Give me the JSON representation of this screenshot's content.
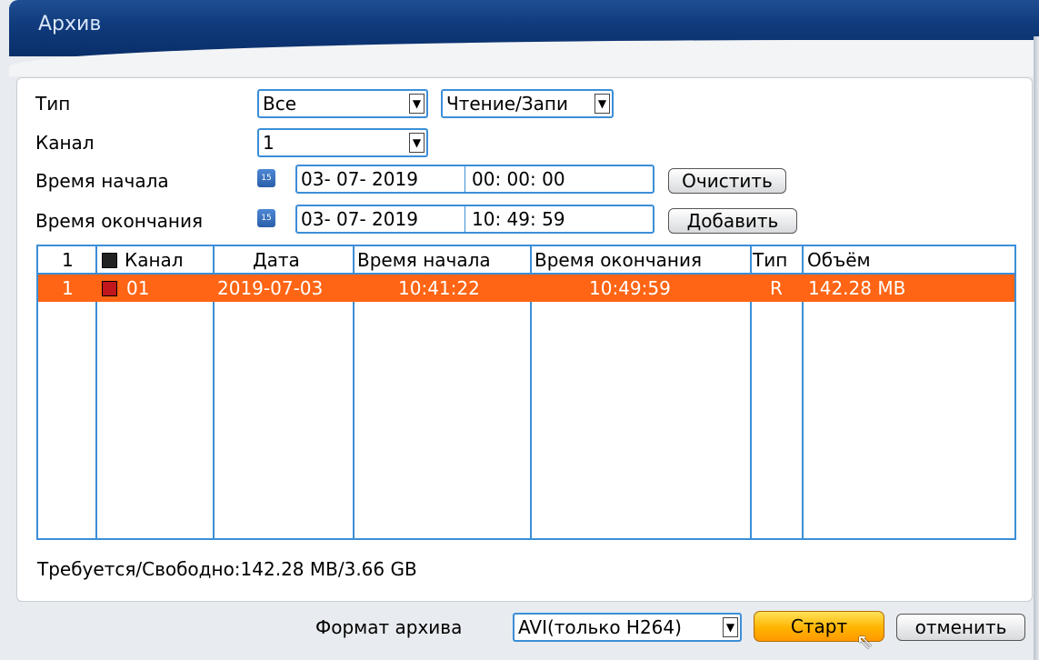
{
  "window": {
    "title": "Архив"
  },
  "form": {
    "type_label": "Тип",
    "type_value": "Все",
    "mode_value": "Чтение/Запи",
    "channel_label": "Канал",
    "channel_value": "1",
    "start_label": "Время начала",
    "start_date": "03- 07- 2019",
    "start_time": "00: 00: 00",
    "end_label": "Время окончания",
    "end_date": "03- 07- 2019",
    "end_time": "10: 49: 59",
    "clear_button": "Очистить",
    "add_button": "Добавить",
    "calendar_icon_text": "15"
  },
  "table": {
    "headers": {
      "index": "1",
      "channel": "Канал",
      "date": "Дата",
      "start": "Время начала",
      "end": "Время окончания",
      "type": "Тип",
      "size": "Объём"
    },
    "rows": [
      {
        "index": "1",
        "channel": "01",
        "date": "2019-07-03",
        "start": "10:41:22",
        "end": "10:49:59",
        "type": "R",
        "size": "142.28 MB"
      }
    ],
    "selection_color": "#ff6514"
  },
  "status": {
    "required_free": "Требуется/Свободно:142.28 MB/3.66 GB"
  },
  "bottom": {
    "format_label": "Формат архива",
    "format_value": "AVI(только H264)",
    "start_button": "Старт",
    "cancel_button": "отменить"
  },
  "colors": {
    "accent": "#3b8ed8",
    "title_bar": "#0f3a7c",
    "start_button": "#ffb300"
  }
}
